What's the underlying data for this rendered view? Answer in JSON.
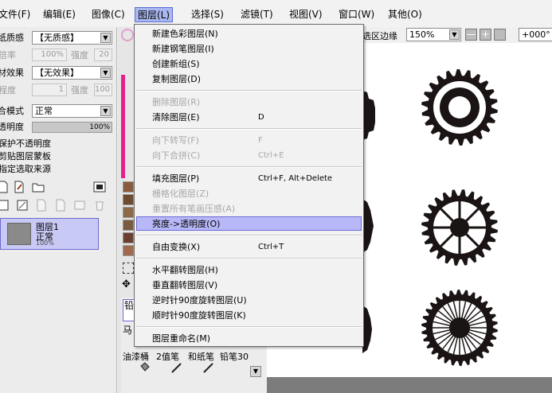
{
  "menubar": {
    "items": [
      {
        "label": "文件(F)"
      },
      {
        "label": "编辑(E)"
      },
      {
        "label": "图像(C)"
      },
      {
        "label": "图层(L)"
      },
      {
        "label": "选择(S)"
      },
      {
        "label": "滤镜(T)"
      },
      {
        "label": "视图(V)"
      },
      {
        "label": "窗口(W)"
      },
      {
        "label": "其他(O)"
      }
    ]
  },
  "left_panel": {
    "paper_texture_label": "纸质感",
    "paper_texture_value": "【无质感】",
    "rate_label": "倍率",
    "rate_value": "100%",
    "strength_label": "强度",
    "strength_value": "20",
    "material_effect_label": "材效果",
    "material_effect_value": "【无效果】",
    "degree_label": "程度",
    "degree_value": "1",
    "strength2_label": "强度",
    "strength2_value": "100",
    "blend_mode_label": "合模式",
    "blend_mode_value": "正常",
    "opacity_label": "透明度",
    "opacity_value": "100%",
    "opacity_fraction": 1.0,
    "check_protect": "保护不透明度",
    "check_clip": "剪贴图层蒙板",
    "check_select_source": "指定选取来源",
    "layer": {
      "name": "图层1",
      "mode": "正常",
      "opacity": "100%"
    }
  },
  "toolbar_right": {
    "select_edge_label": "选区边缘",
    "zoom_value": "150%",
    "angle_value": "+000°"
  },
  "tool_panel": {
    "tab1": "铅",
    "tab2": "马",
    "tools": [
      "油漆桶",
      "2值笔",
      "和纸笔",
      "铅笔30"
    ]
  },
  "dropdown": {
    "items": [
      {
        "label": "新建色彩图层(N)",
        "shortcut": "",
        "disabled": false
      },
      {
        "label": "新建钢笔图层(I)",
        "shortcut": "",
        "disabled": false
      },
      {
        "label": "创建新组(S)",
        "shortcut": "",
        "disabled": false
      },
      {
        "label": "复制图层(D)",
        "shortcut": "",
        "disabled": false
      },
      {
        "label": "删除图层(R)",
        "shortcut": "",
        "disabled": true
      },
      {
        "label": "清除图层(E)",
        "shortcut": "D",
        "disabled": false
      },
      {
        "label": "向下转写(F)",
        "shortcut": "F",
        "disabled": true
      },
      {
        "label": "向下合拼(C)",
        "shortcut": "Ctrl+E",
        "disabled": true
      },
      {
        "label": "填充图层(P)",
        "shortcut": "Ctrl+F, Alt+Delete",
        "disabled": false
      },
      {
        "label": "栅格化图层(Z)",
        "shortcut": "",
        "disabled": true
      },
      {
        "label": "重置所有笔画压感(A)",
        "shortcut": "",
        "disabled": true
      },
      {
        "label": "亮度->透明度(O)",
        "shortcut": "",
        "disabled": false,
        "highlighted": true
      },
      {
        "label": "自由变换(X)",
        "shortcut": "Ctrl+T",
        "disabled": false
      },
      {
        "label": "水平翻转图层(H)",
        "shortcut": "",
        "disabled": false
      },
      {
        "label": "垂直翻转图层(V)",
        "shortcut": "",
        "disabled": false
      },
      {
        "label": "逆时针90度旋转图层(U)",
        "shortcut": "",
        "disabled": false
      },
      {
        "label": "顺时针90度旋转图层(K)",
        "shortcut": "",
        "disabled": false
      },
      {
        "label": "图层重命名(M)",
        "shortcut": "",
        "disabled": false
      }
    ]
  },
  "colors": {
    "highlight": "#b8b8f8",
    "highlight_border": "#6a6ad8",
    "layer_selected": "#c9c9f5",
    "gear": "#1a1414",
    "swatches": [
      "#8a5a3c",
      "#6e4a30",
      "#8c6a48",
      "#7a5a40",
      "#6a4030",
      "#a06a50"
    ]
  },
  "icons": [
    "folder-icon",
    "new-layer-icon",
    "pen-layer-icon",
    "mask-icon",
    "trash-icon",
    "bucket-icon",
    "pen-icon",
    "pencil-icon"
  ]
}
